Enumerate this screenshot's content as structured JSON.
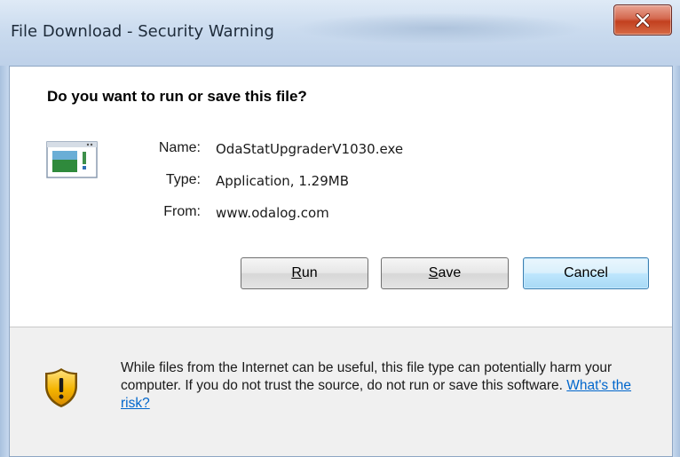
{
  "window": {
    "title": "File Download - Security Warning",
    "close_icon": "close-icon"
  },
  "dialog": {
    "question": "Do you want to run or save this file?",
    "file_icon": "application-file-icon",
    "details": {
      "name_label": "Name:",
      "name_value": "OdaStatUpgraderV1030.exe",
      "type_label": "Type:",
      "type_value": "Application, 1.29MB",
      "from_label": "From:",
      "from_value": "www.odalog.com"
    },
    "buttons": {
      "run_mnemonic": "R",
      "run_rest": "un",
      "save_mnemonic": "S",
      "save_rest": "ave",
      "cancel": "Cancel"
    }
  },
  "footer": {
    "shield_icon": "security-shield-icon",
    "warning_text": "While files from the Internet can be useful, this file type can potentially harm your computer. If you do not trust the source, do not run or save this software.",
    "risk_link": "What's the risk?"
  },
  "colors": {
    "link": "#0066cc",
    "close_button": "#c2401f",
    "default_button_border": "#3c7fb1",
    "shield": "#f0b400"
  }
}
